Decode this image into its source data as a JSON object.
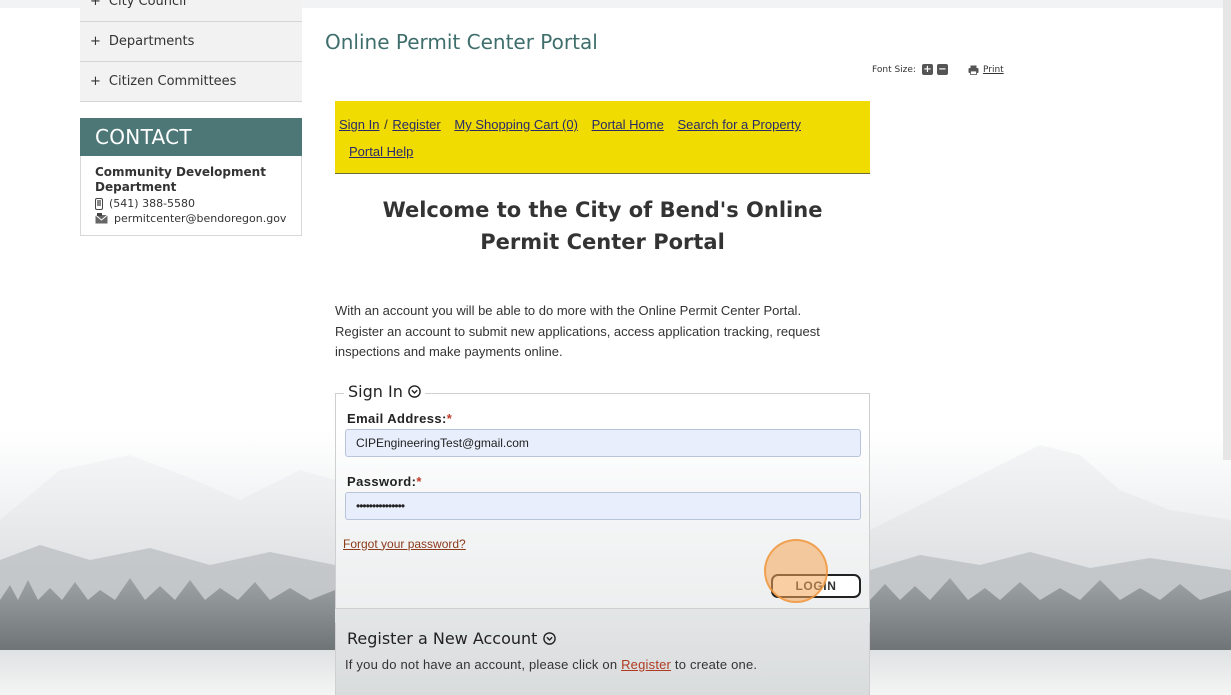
{
  "sidebar": {
    "items": [
      {
        "label": "City Council"
      },
      {
        "label": "Departments"
      },
      {
        "label": "Citizen Committees"
      }
    ],
    "contact": {
      "heading": "CONTACT",
      "department": "Community Development Department",
      "phone": "(541) 388-5580",
      "email": "permitcenter@bendoregon.gov"
    }
  },
  "header": {
    "title": "Online Permit Center Portal",
    "font_size_label": "Font Size:",
    "print_label": "Print"
  },
  "nav": {
    "sign_in": "Sign In",
    "register": "Register",
    "cart": "My Shopping Cart (0)",
    "home": "Portal Home",
    "search": "Search for a Property",
    "help": "Portal Help"
  },
  "welcome": {
    "title": "Welcome to the City of Bend's Online Permit Center Portal",
    "intro": "With an account you will be able to do more with the Online Permit Center Portal. Register an account to submit new applications, access application tracking, request inspections and make payments online."
  },
  "signin": {
    "legend": "Sign In",
    "email_label": "Email Address:",
    "email_value": "CIPEngineeringTest@gmail.com",
    "password_label": "Password:",
    "password_value": "•••••••••••••••",
    "forgot": "Forgot your password?",
    "login_label": "LOGIN",
    "required_mark": "*"
  },
  "register_section": {
    "title": "Register a New Account",
    "text_before": "If you do not have an account, please click on",
    "link": "Register",
    "text_after": "to create one."
  },
  "colors": {
    "brand_teal": "#4d7776",
    "nav_yellow": "#f0dc00",
    "input_bg": "#e8eefc",
    "click_highlight": "#f4a555"
  }
}
